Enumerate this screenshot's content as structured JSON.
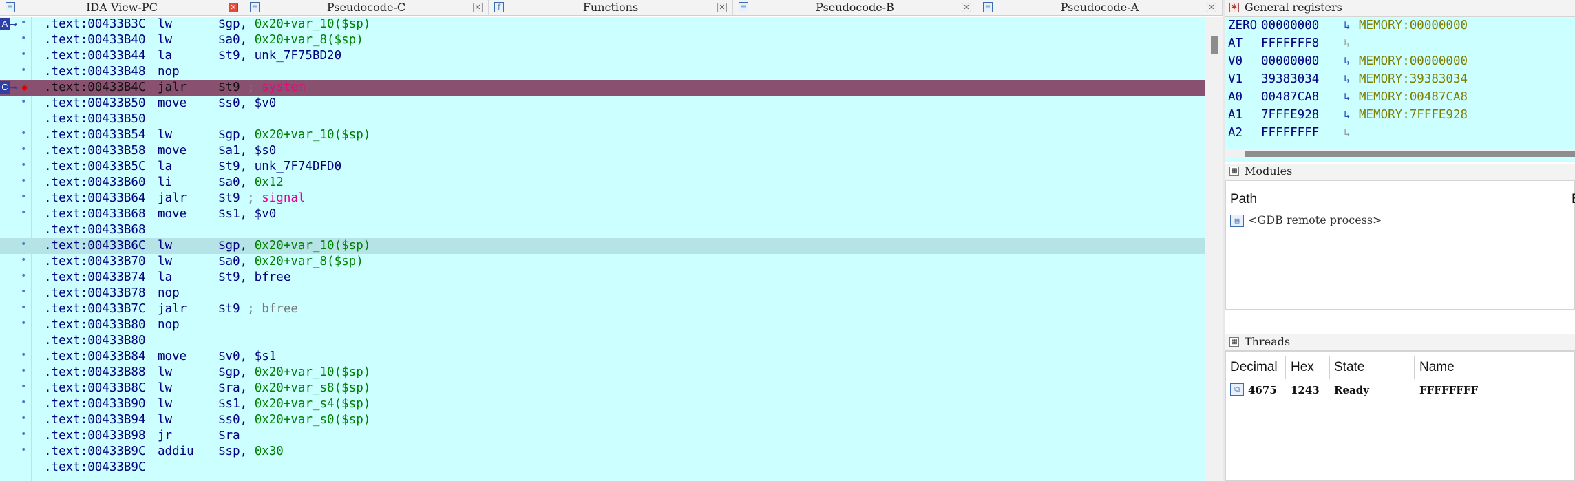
{
  "tabs": [
    {
      "label": "IDA View-PC",
      "icon": "ida-view-icon",
      "close": "active"
    },
    {
      "label": "Pseudocode-C",
      "icon": "pseudocode-icon",
      "close": "normal"
    },
    {
      "label": "Functions",
      "icon": "functions-icon",
      "close": "normal"
    },
    {
      "label": "Pseudocode-B",
      "icon": "pseudocode-icon",
      "close": "normal"
    },
    {
      "label": "Pseudocode-A",
      "icon": "pseudocode-icon",
      "close": "normal"
    }
  ],
  "markers": {
    "a": "A",
    "c": "C"
  },
  "code_lines": [
    {
      "addr": ".text:00433B3C",
      "mn": "lw",
      "ops": "$gp, ",
      "num": "0x20",
      "rest": "+var_10($sp)",
      "dot": true
    },
    {
      "addr": ".text:00433B40",
      "mn": "lw",
      "ops": "$a0, ",
      "num": "0x20",
      "rest": "+var_8($sp)",
      "dot": true
    },
    {
      "addr": ".text:00433B44",
      "mn": "la",
      "ops": "$t9, unk_7F75BD20",
      "dot": true
    },
    {
      "addr": ".text:00433B48",
      "mn": "nop",
      "ops": "",
      "dot": true
    },
    {
      "addr": ".text:00433B4C",
      "mn": "jalr",
      "ops": "$t9 ",
      "cmt": "; ",
      "ref": "system",
      "dot": false,
      "hl": "bp"
    },
    {
      "addr": ".text:00433B50",
      "mn": "move",
      "ops": "$s0, $v0",
      "dot": true
    },
    {
      "addr": ".text:00433B50",
      "mn": "",
      "ops": "",
      "dot": false
    },
    {
      "addr": ".text:00433B54",
      "mn": "lw",
      "ops": "$gp, ",
      "num": "0x20",
      "rest": "+var_10($sp)",
      "dot": true
    },
    {
      "addr": ".text:00433B58",
      "mn": "move",
      "ops": "$a1, $s0",
      "dot": true
    },
    {
      "addr": ".text:00433B5C",
      "mn": "la",
      "ops": "$t9, unk_7F74DFD0",
      "dot": true
    },
    {
      "addr": ".text:00433B60",
      "mn": "li",
      "ops": "$a0, ",
      "num": "0x12",
      "dot": true
    },
    {
      "addr": ".text:00433B64",
      "mn": "jalr",
      "ops": "$t9 ",
      "cmt": "; ",
      "ref": "signal",
      "dot": true
    },
    {
      "addr": ".text:00433B68",
      "mn": "move",
      "ops": "$s1, $v0",
      "dot": true
    },
    {
      "addr": ".text:00433B68",
      "mn": "",
      "ops": "",
      "dot": false
    },
    {
      "addr": ".text:00433B6C",
      "mn": "lw",
      "ops": "$gp, ",
      "num": "0x20",
      "rest": "+var_10($sp)",
      "dot": true,
      "hl": "cur"
    },
    {
      "addr": ".text:00433B70",
      "mn": "lw",
      "ops": "$a0, ",
      "num": "0x20",
      "rest": "+var_8($sp)",
      "dot": true
    },
    {
      "addr": ".text:00433B74",
      "mn": "la",
      "ops": "$t9, bfree",
      "dot": true
    },
    {
      "addr": ".text:00433B78",
      "mn": "nop",
      "ops": "",
      "dot": true
    },
    {
      "addr": ".text:00433B7C",
      "mn": "jalr",
      "ops": "$t9 ",
      "cmt": "; bfree",
      "dot": true
    },
    {
      "addr": ".text:00433B80",
      "mn": "nop",
      "ops": "",
      "dot": true
    },
    {
      "addr": ".text:00433B80",
      "mn": "",
      "ops": "",
      "dot": false
    },
    {
      "addr": ".text:00433B84",
      "mn": "move",
      "ops": "$v0, $s1",
      "dot": true
    },
    {
      "addr": ".text:00433B88",
      "mn": "lw",
      "ops": "$gp, ",
      "num": "0x20",
      "rest": "+var_10($sp)",
      "dot": true
    },
    {
      "addr": ".text:00433B8C",
      "mn": "lw",
      "ops": "$ra, ",
      "num": "0x20",
      "rest": "+var_s8($sp)",
      "dot": true
    },
    {
      "addr": ".text:00433B90",
      "mn": "lw",
      "ops": "$s1, ",
      "num": "0x20",
      "rest": "+var_s4($sp)",
      "dot": true
    },
    {
      "addr": ".text:00433B94",
      "mn": "lw",
      "ops": "$s0, ",
      "num": "0x20",
      "rest": "+var_s0($sp)",
      "dot": true
    },
    {
      "addr": ".text:00433B98",
      "mn": "jr",
      "ops": "$ra",
      "dot": true
    },
    {
      "addr": ".text:00433B9C",
      "mn": "addiu",
      "ops": "$sp, ",
      "num": "0x30",
      "dot": true
    },
    {
      "addr": ".text:00433B9C",
      "mn": "",
      "ops": "",
      "dot": false
    }
  ],
  "registers_panel": {
    "title": "General registers",
    "icon": "bug-icon",
    "regs": [
      {
        "name": "ZERO",
        "value": "00000000",
        "mem": "MEMORY:00000000"
      },
      {
        "name": "AT",
        "value": "FFFFFFF8",
        "mem": ""
      },
      {
        "name": "V0",
        "value": "00000000",
        "mem": "MEMORY:00000000"
      },
      {
        "name": "V1",
        "value": "39383034",
        "mem": "MEMORY:39383034"
      },
      {
        "name": "A0",
        "value": "00487CA8",
        "mem": "MEMORY:00487CA8"
      },
      {
        "name": "A1",
        "value": "7FFFE928",
        "mem": "MEMORY:7FFFE928"
      },
      {
        "name": "A2",
        "value": "FFFFFFFF",
        "mem": ""
      }
    ]
  },
  "modules_panel": {
    "title": "Modules",
    "col_path": "Path",
    "col_b": "B",
    "item": "<GDB remote process>"
  },
  "threads_panel": {
    "title": "Threads",
    "cols": [
      "Decimal",
      "Hex",
      "State",
      "Name"
    ],
    "row": {
      "decimal": "4675",
      "hex": "1243",
      "state": "Ready",
      "name": "FFFFFFFF"
    }
  }
}
